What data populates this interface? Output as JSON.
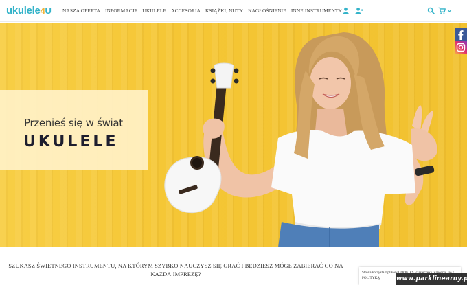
{
  "logo": {
    "part1": "ukulele",
    "part2": "4",
    "part3": "U"
  },
  "nav": [
    "NASZA OFERTA",
    "INFORMACJE",
    "UKULELE",
    "ACCESORIA",
    "KSIĄŻKI, NUTY",
    "NAGŁOŚNIENIE",
    "INNE INSTRUMENTY"
  ],
  "header_icons": [
    "user-icon",
    "user-add-icon",
    "search-icon",
    "cart-icon",
    "chevron-down-icon"
  ],
  "social": [
    "facebook-icon",
    "instagram-icon"
  ],
  "hero": {
    "subtitle": "Przenieś się w świat",
    "title": "UKULELE"
  },
  "tagline": "SZUKASZ ŚWIETNEGO INSTRUMENTU, NA KTÓRYM SZYBKO NAUCZYSZ SIĘ GRAĆ I BĘDZIESZ MÓGŁ ZABIERAĆ GO NA KAŻDĄ IMPREZĘ?",
  "cookie": {
    "text": "Strona korzysta z plików COOKIES (ciasteczek). Zapoznaj się z POLITYKĄ"
  },
  "watermark": "www.parklinearny.pl",
  "colors": {
    "accent": "#33b3c9",
    "brand_yellow": "#f1b43b",
    "hero_bg": "#f5c634",
    "box": "#fff1c7"
  }
}
